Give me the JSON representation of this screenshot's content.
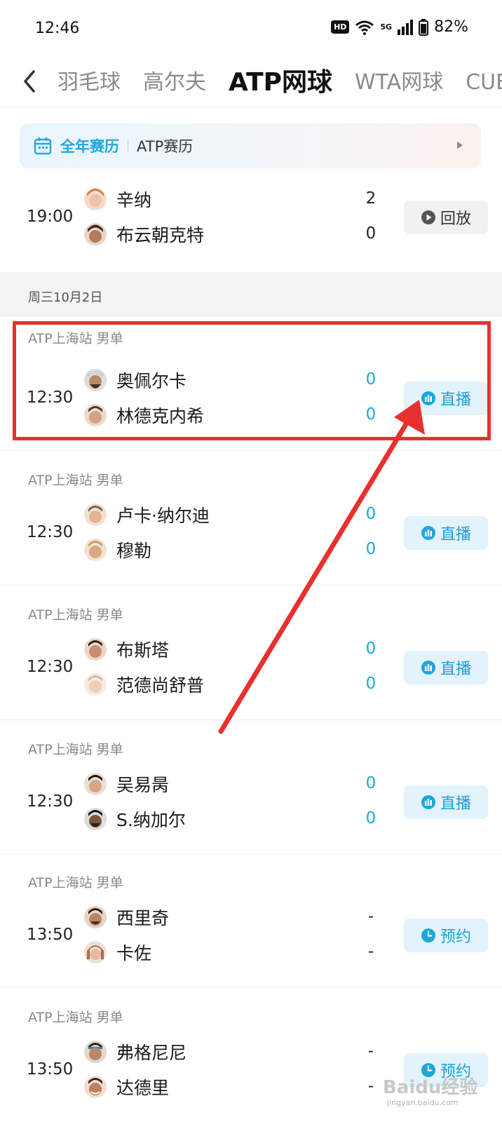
{
  "status_bar": {
    "time": "12:46",
    "hd": "HD",
    "network": "5G",
    "battery": "82%"
  },
  "nav": {
    "tabs": [
      "羽毛球",
      "高尔夫",
      "ATP网球",
      "WTA网球",
      "CUB"
    ],
    "active_index": 2
  },
  "banner": {
    "title": "全年赛历",
    "subtitle": "ATP赛历"
  },
  "date_separator": "周三10月2日",
  "matches": [
    {
      "competition": "",
      "time": "19:00",
      "p1": "辛纳",
      "p2": "布云朝克特",
      "s1": "2",
      "s2": "0",
      "action": "回放",
      "status": "finished"
    },
    {
      "competition": "ATP上海站 男单",
      "time": "12:30",
      "p1": "奥佩尔卡",
      "p2": "林德克内希",
      "s1": "0",
      "s2": "0",
      "action": "直播",
      "status": "live"
    },
    {
      "competition": "ATP上海站 男单",
      "time": "12:30",
      "p1": "卢卡·纳尔迪",
      "p2": "穆勒",
      "s1": "0",
      "s2": "0",
      "action": "直播",
      "status": "live"
    },
    {
      "competition": "ATP上海站 男单",
      "time": "12:30",
      "p1": "布斯塔",
      "p2": "范德尚舒普",
      "s1": "0",
      "s2": "0",
      "action": "直播",
      "status": "live"
    },
    {
      "competition": "ATP上海站 男单",
      "time": "12:30",
      "p1": "吴易昺",
      "p2": "S.纳加尔",
      "s1": "0",
      "s2": "0",
      "action": "直播",
      "status": "live"
    },
    {
      "competition": "ATP上海站 男单",
      "time": "13:50",
      "p1": "西里奇",
      "p2": "卡佐",
      "s1": "-",
      "s2": "-",
      "action": "预约",
      "status": "scheduled"
    },
    {
      "competition": "ATP上海站 男单",
      "time": "13:50",
      "p1": "弗格尼尼",
      "p2": "达德里",
      "s1": "-",
      "s2": "-",
      "action": "预约",
      "status": "scheduled"
    }
  ],
  "watermark": {
    "text": "Baidu经验",
    "url": "jingyan.baidu.com"
  },
  "colors": {
    "accent": "#1fa7d8",
    "highlight": "#e8302e",
    "text_primary": "#1a1a1a",
    "text_secondary": "#888888"
  }
}
